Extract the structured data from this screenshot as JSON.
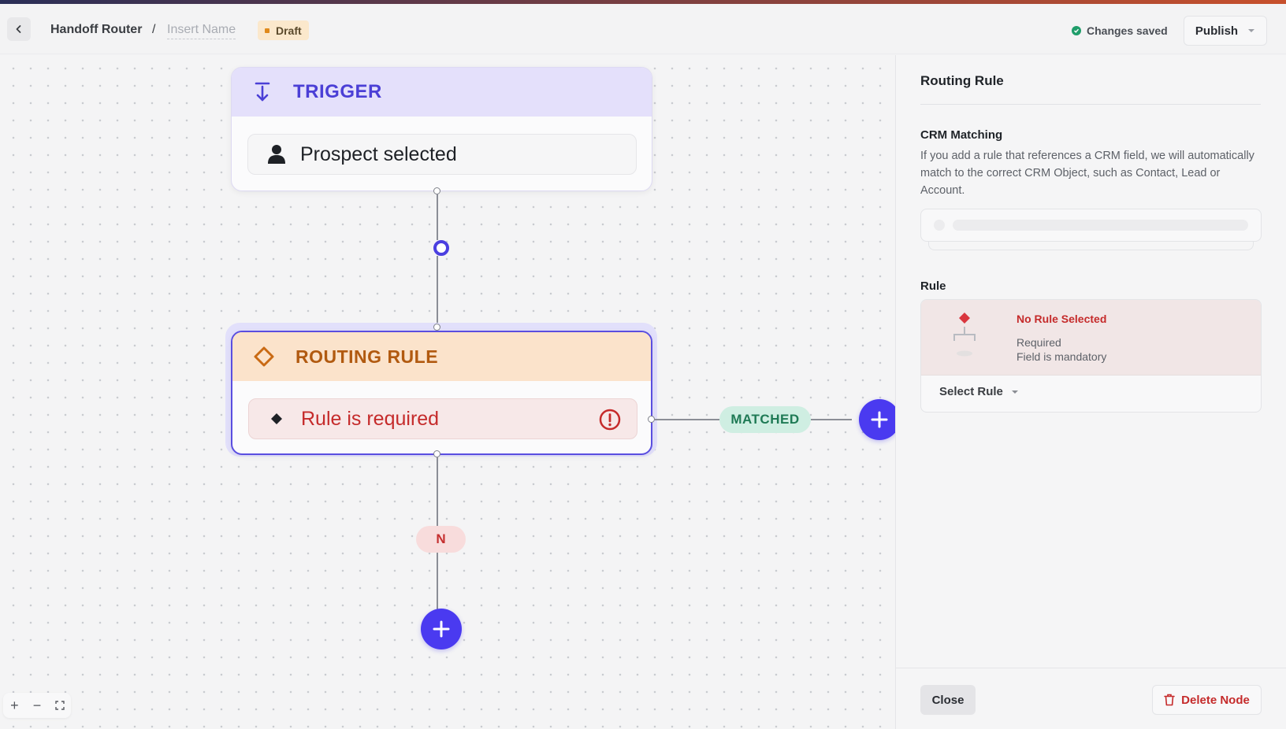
{
  "header": {
    "breadcrumb_root": "Handoff Router",
    "breadcrumb_separator": "/",
    "name_placeholder": "Insert Name",
    "status_badge": "Draft",
    "save_status": "Changes saved",
    "publish_label": "Publish"
  },
  "canvas": {
    "trigger": {
      "title": "TRIGGER",
      "event": "Prospect selected",
      "icon": "person-icon"
    },
    "routing_rule": {
      "title": "ROUTING RULE",
      "message": "Rule is required",
      "icon": "diamond-icon"
    },
    "branch_matched_label": "MATCHED",
    "branch_no_label": "N",
    "zoom_controls": {
      "zoom_in": "+",
      "zoom_out": "−",
      "fit": "⛶"
    }
  },
  "panel": {
    "title": "Routing Rule",
    "crm_label": "CRM Matching",
    "crm_description": "If you add a rule that references a CRM field, we will automatically match to the correct CRM Object, such as Contact, Lead or Account.",
    "rule_label": "Rule",
    "rule_empty_title": "No Rule Selected",
    "rule_empty_line1": "Required",
    "rule_empty_line2": "Field is mandatory",
    "select_rule_label": "Select Rule",
    "close_label": "Close",
    "delete_label": "Delete Node"
  },
  "colors": {
    "accent": "#4a3af0",
    "trigger_header": "#e4e0fb",
    "routing_header": "#fbe3cb",
    "error": "#c52b2b",
    "matched": "#cfeee2",
    "saved": "#1f9d6a"
  }
}
